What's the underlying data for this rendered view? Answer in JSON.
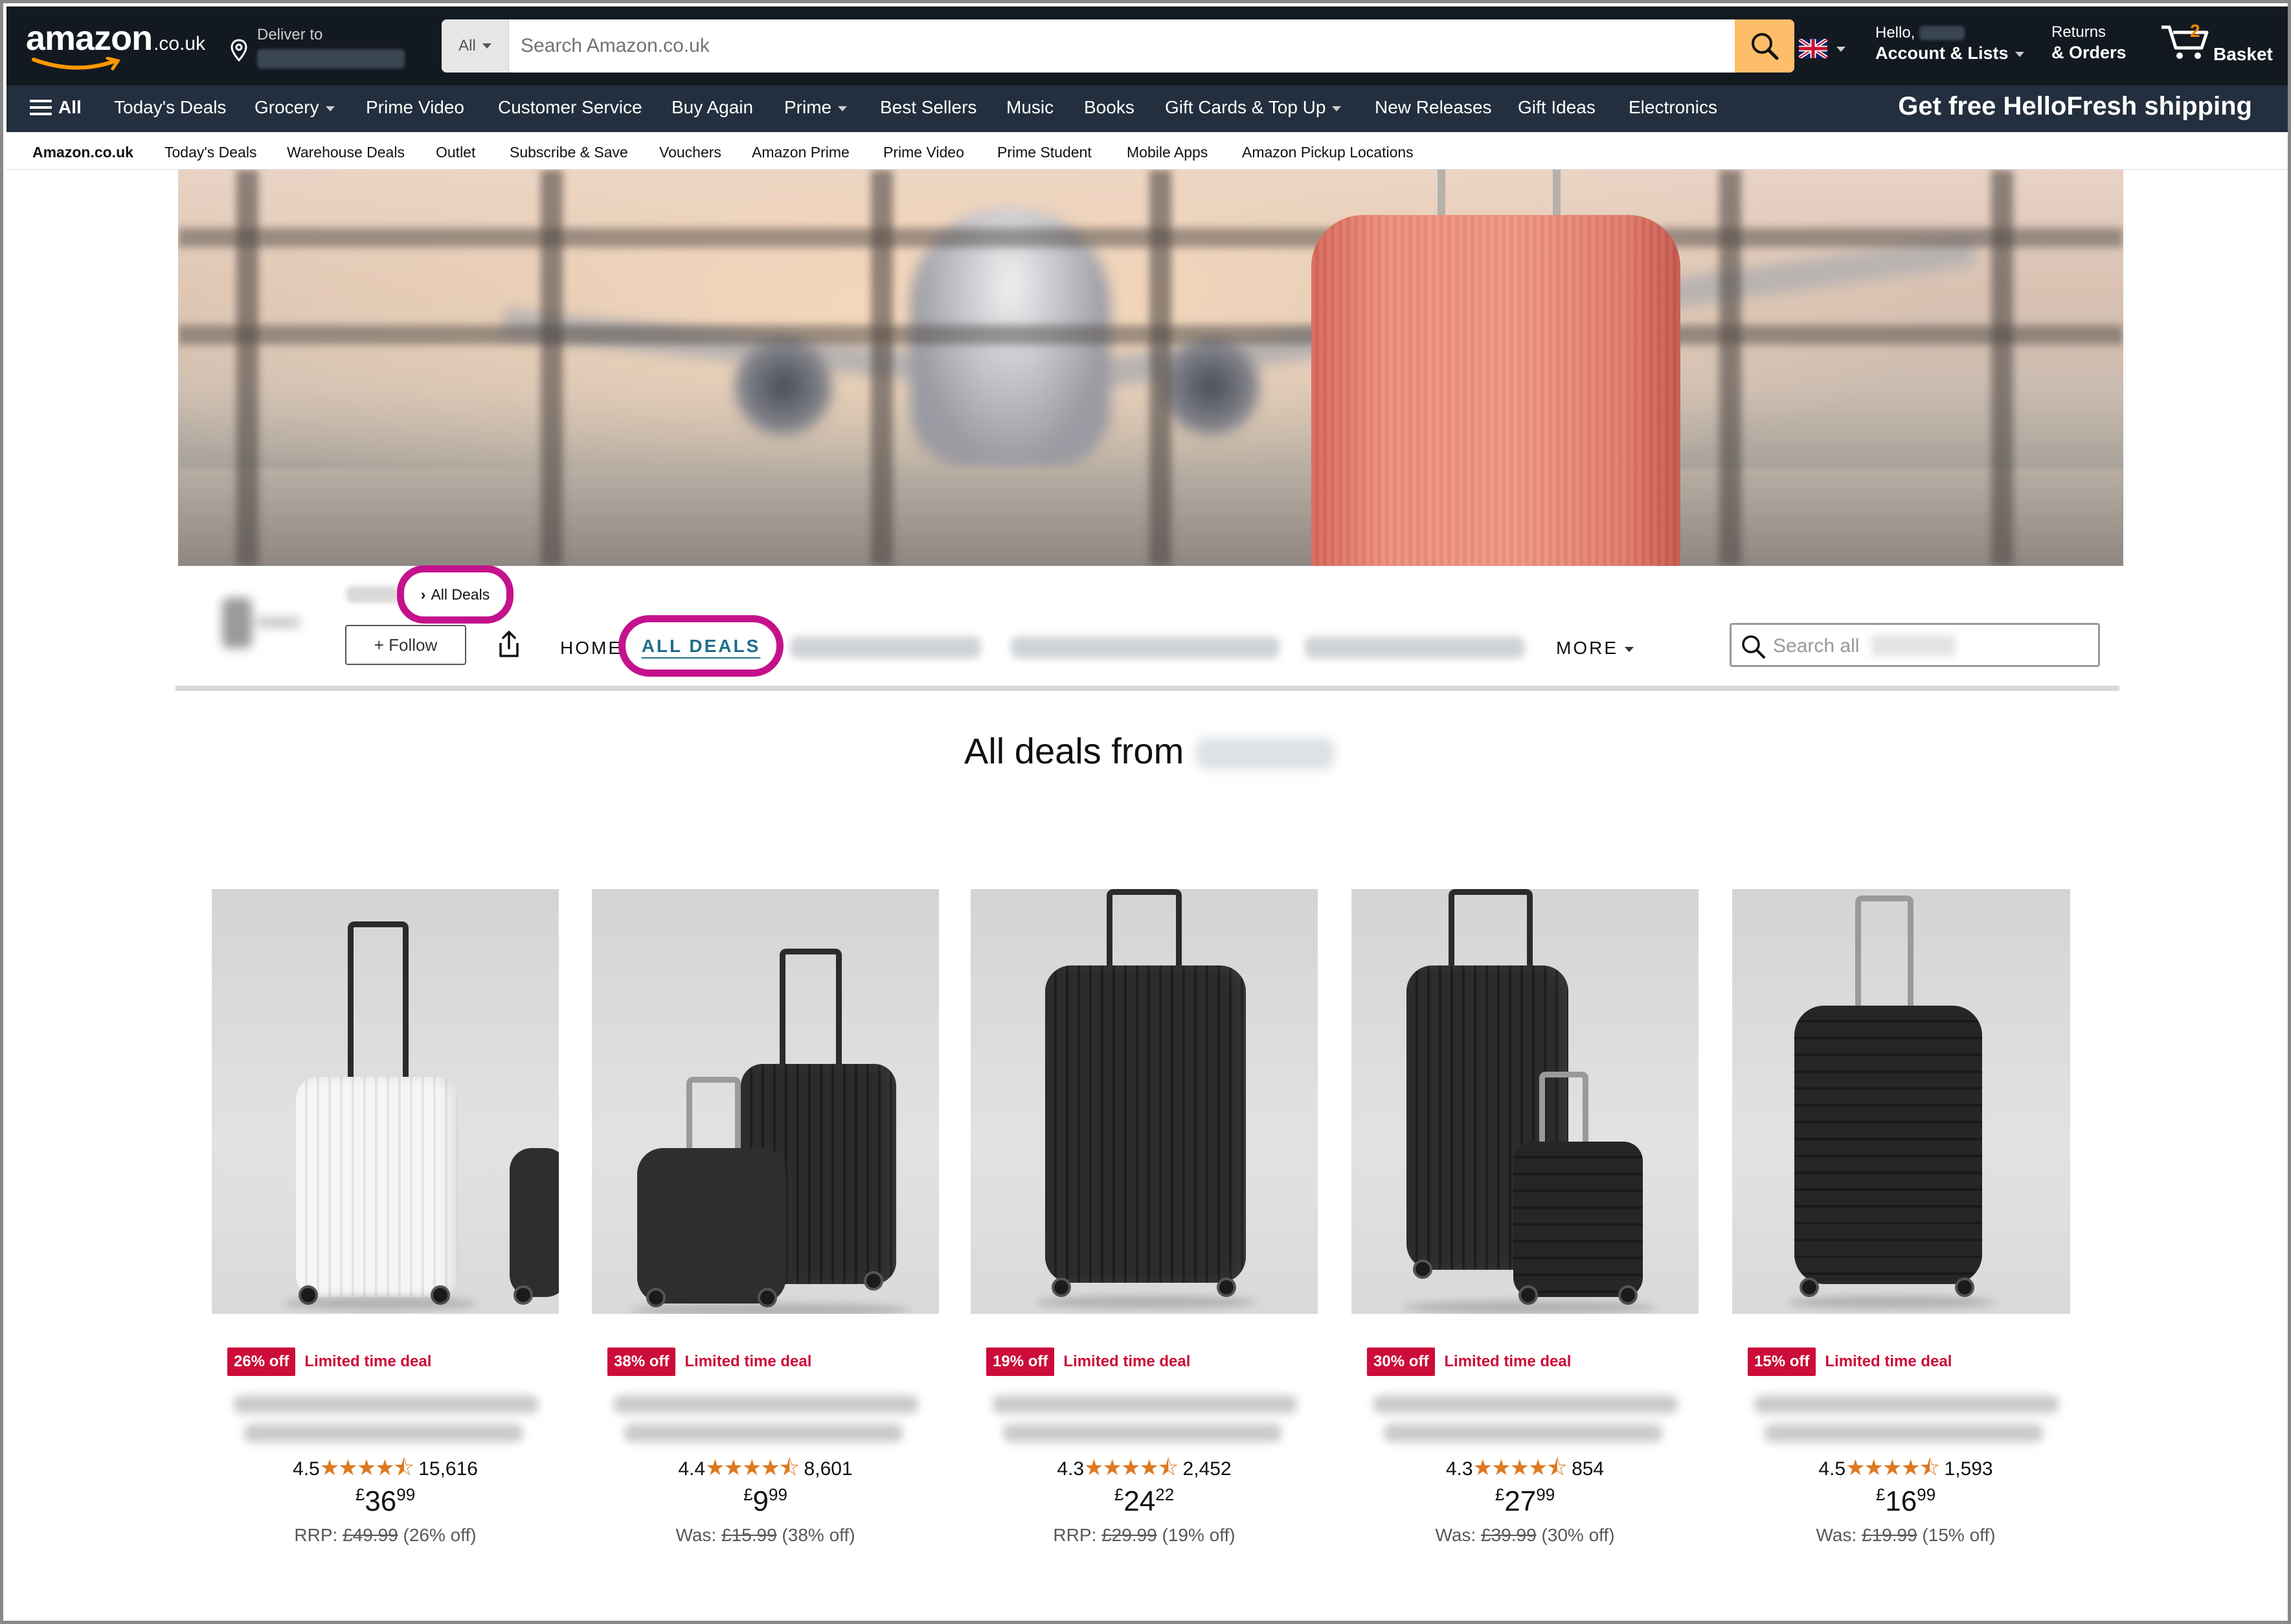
{
  "header": {
    "logo_text": "amazon",
    "logo_tld": ".co.uk",
    "deliver_label": "Deliver to",
    "search_category": "All",
    "search_placeholder": "Search Amazon.co.uk",
    "account_hello": "Hello,",
    "account_label": "Account & Lists",
    "returns_line1": "Returns",
    "returns_line2": "& Orders",
    "basket_count": "2",
    "basket_label": "Basket"
  },
  "main_nav": {
    "all_label": "All",
    "items": [
      "Today's Deals",
      "Grocery",
      "Prime Video",
      "Customer Service",
      "Buy Again",
      "Prime",
      "Best Sellers",
      "Music",
      "Books",
      "Gift Cards & Top Up",
      "New Releases",
      "Gift Ideas",
      "Electronics"
    ],
    "promo": "Get free HelloFresh shipping"
  },
  "sub_nav": {
    "items": [
      "Amazon.co.uk",
      "Today's Deals",
      "Warehouse Deals",
      "Outlet",
      "Subscribe & Save",
      "Vouchers",
      "Amazon Prime",
      "Prime Video",
      "Prime Student",
      "Mobile Apps",
      "Amazon Pickup Locations"
    ]
  },
  "store": {
    "breadcrumb": "All Deals",
    "follow_label": "+ Follow",
    "tabs": {
      "home": "HOME",
      "all_deals": "ALL DEALS",
      "more": "MORE"
    },
    "search_placeholder": "Search all",
    "section_title": "All deals from"
  },
  "products": [
    {
      "discount_badge": "26% off",
      "deal_label": "Limited time deal",
      "rating": "4.5",
      "stars": "★★★★⯪",
      "review_count": "15,616",
      "price_symbol": "£",
      "price_whole": "36",
      "price_fraction": "99",
      "was_label": "RRP:",
      "was_price": "£49.99",
      "was_pct": "(26% off)"
    },
    {
      "discount_badge": "38% off",
      "deal_label": "Limited time deal",
      "rating": "4.4",
      "stars": "★★★★⯪",
      "review_count": "8,601",
      "price_symbol": "£",
      "price_whole": "9",
      "price_fraction": "99",
      "was_label": "Was:",
      "was_price": "£15.99",
      "was_pct": "(38% off)"
    },
    {
      "discount_badge": "19% off",
      "deal_label": "Limited time deal",
      "rating": "4.3",
      "stars": "★★★★⯪",
      "review_count": "2,452",
      "price_symbol": "£",
      "price_whole": "24",
      "price_fraction": "22",
      "was_label": "RRP:",
      "was_price": "£29.99",
      "was_pct": "(19% off)"
    },
    {
      "discount_badge": "30% off",
      "deal_label": "Limited time deal",
      "rating": "4.3",
      "stars": "★★★★⯪",
      "review_count": "854",
      "price_symbol": "£",
      "price_whole": "27",
      "price_fraction": "99",
      "was_label": "Was:",
      "was_price": "£39.99",
      "was_pct": "(30% off)"
    },
    {
      "discount_badge": "15% off",
      "deal_label": "Limited time deal",
      "rating": "4.5",
      "stars": "★★★★⯪",
      "review_count": "1,593",
      "price_symbol": "£",
      "price_whole": "16",
      "price_fraction": "99",
      "was_label": "Was:",
      "was_price": "£19.99",
      "was_pct": "(15% off)"
    }
  ],
  "colors": {
    "nav_dark": "#131921",
    "nav_main": "#232F3E",
    "search_button": "#FEBD69",
    "deal_red": "#CC0C39",
    "star_orange": "#DE7921",
    "highlight_ring": "#C4128C",
    "active_tab_teal": "#1f6e8c"
  },
  "icons": {
    "location": "location-pin-icon",
    "search": "magnifier-icon",
    "flag": "uk-flag-icon",
    "basket": "cart-icon",
    "menu": "hamburger-icon",
    "share": "share-icon"
  }
}
